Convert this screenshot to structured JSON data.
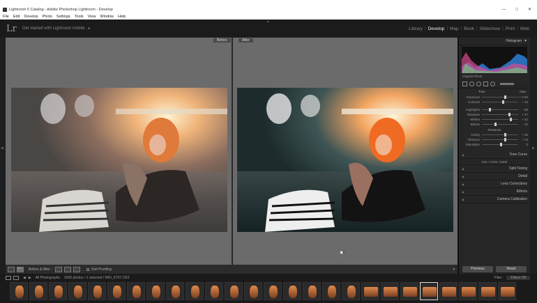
{
  "window": {
    "title": "Lightroom 5 Catalog - Adobe Photoshop Lightroom - Develop",
    "controls": [
      "—",
      "□",
      "✕"
    ]
  },
  "menu": [
    "File",
    "Edit",
    "Develop",
    "Photo",
    "Settings",
    "Tools",
    "View",
    "Window",
    "Help"
  ],
  "identity": {
    "logo": "Lr",
    "tagline": "Get started with Lightroom mobile",
    "arrow": "►"
  },
  "modules": [
    {
      "label": "Library",
      "active": false
    },
    {
      "label": "Develop",
      "active": true
    },
    {
      "label": "Map",
      "active": false
    },
    {
      "label": "Book",
      "active": false
    },
    {
      "label": "Slideshow",
      "active": false
    },
    {
      "label": "Print",
      "active": false
    },
    {
      "label": "Web",
      "active": false
    }
  ],
  "view": {
    "before_tag": "Before",
    "after_tag": "After"
  },
  "toolbar": {
    "mode_label": "Before & After :",
    "soft_proofing": "Soft Proofing"
  },
  "panel": {
    "histogram": "Histogram",
    "original_photo": "Original Photo",
    "tone": "Tone",
    "auto": "Auto",
    "presence": "Presence",
    "tone_sliders": [
      {
        "label": "Exposure",
        "value": "+ 0.82",
        "pos": 0.62
      },
      {
        "label": "Contrast",
        "value": "+ 16",
        "pos": 0.56
      }
    ],
    "tone_sliders2": [
      {
        "label": "Highlights",
        "value": "- 58",
        "pos": 0.2
      },
      {
        "label": "Shadows",
        "value": "+ 47",
        "pos": 0.74
      },
      {
        "label": "Whites",
        "value": "+ 52",
        "pos": 0.76
      },
      {
        "label": "Blacks",
        "value": "- 32",
        "pos": 0.34
      }
    ],
    "presence_sliders": [
      {
        "label": "Clarity",
        "value": "+ 25",
        "pos": 0.62
      },
      {
        "label": "Vibrance",
        "value": "+ 23",
        "pos": 0.61
      },
      {
        "label": "Saturation",
        "value": "0",
        "pos": 0.5
      }
    ],
    "sections": [
      "Tone Curve",
      "Split Toning",
      "Detail",
      "Lens Corrections",
      "Effects",
      "Camera Calibration"
    ],
    "hsl_tabs": "HSL / Color / B&W",
    "previous": "Previous",
    "reset": "Reset"
  },
  "filmstrip": {
    "source": "All Photographs",
    "count": "2000 photos / 1 selected / IMG_9797.CR2",
    "filter_label": "Filter :",
    "filter_value": "Filters Off",
    "thumb_count": 26,
    "selected_index": 21
  }
}
